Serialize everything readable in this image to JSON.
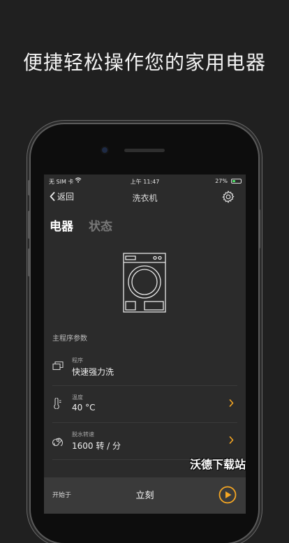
{
  "promo": {
    "title": "便捷轻松操作您的家用电器"
  },
  "status_bar": {
    "carrier": "无 SIM 卡",
    "time": "上午 11:47",
    "battery": "27%"
  },
  "nav": {
    "back_label": "返回",
    "title": "洗衣机"
  },
  "tabs": [
    {
      "label": "电器",
      "active": true
    },
    {
      "label": "状态",
      "active": false
    }
  ],
  "program_params": {
    "section_title": "主程序参数",
    "items": [
      {
        "label": "程序",
        "value": "快速强力洗",
        "icon": "layers-icon",
        "has_chevron": false
      },
      {
        "label": "温度",
        "value": "40 °C",
        "icon": "thermometer-icon",
        "has_chevron": true
      },
      {
        "label": "脱水转速",
        "value": "1600 转 / 分",
        "icon": "spin-icon",
        "has_chevron": true
      }
    ]
  },
  "bottom_bar": {
    "start_label": "开始于",
    "start_value": "立刻"
  },
  "watermark": {
    "text": "沃德下载站"
  },
  "colors": {
    "accent": "#f5a623",
    "screen_bg": "#2b2b2b",
    "page_bg": "#202020"
  }
}
